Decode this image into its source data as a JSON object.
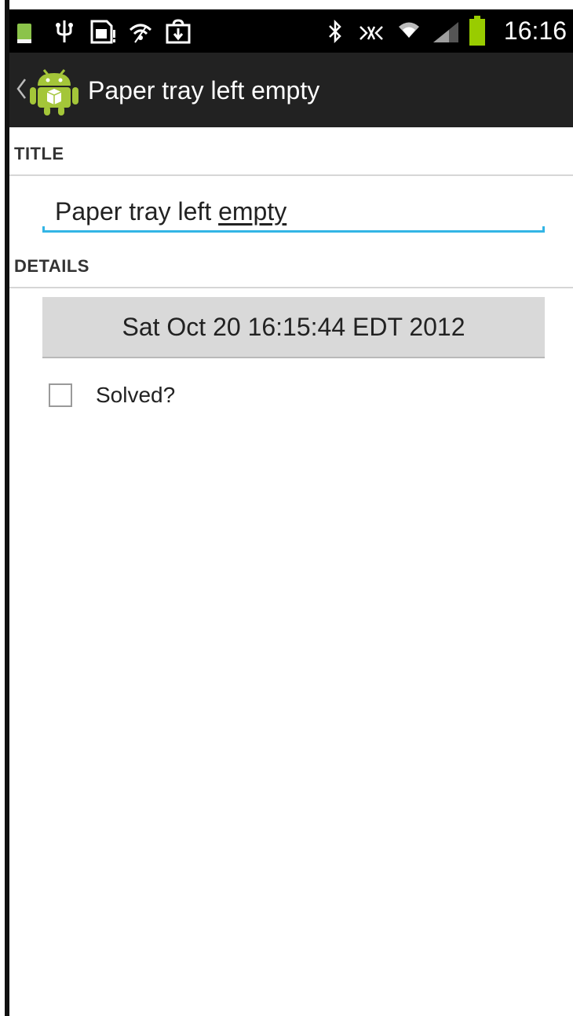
{
  "status_bar": {
    "time": "16:16",
    "icons": [
      "android-battery-notification-icon",
      "usb-icon",
      "sim-card-icon",
      "wifi-hotspot-icon",
      "download-icon",
      "bluetooth-icon",
      "nfc-icon",
      "wifi-icon",
      "signal-icon",
      "battery-icon"
    ],
    "battery_color": "#99cc00"
  },
  "action_bar": {
    "title": "Paper tray left empty",
    "icon": "android-robot-icon",
    "up_icon": "up-caret-icon"
  },
  "sections": {
    "title_header": "TITLE",
    "details_header": "DETAILS"
  },
  "title_field": {
    "value_prefix": "Paper tray left ",
    "value_misspelled": "empty",
    "accent_color": "#33b5e5"
  },
  "details": {
    "date_button": "Sat Oct 20 16:15:44 EDT 2012",
    "solved_label": "Solved?",
    "solved_checked": false
  }
}
